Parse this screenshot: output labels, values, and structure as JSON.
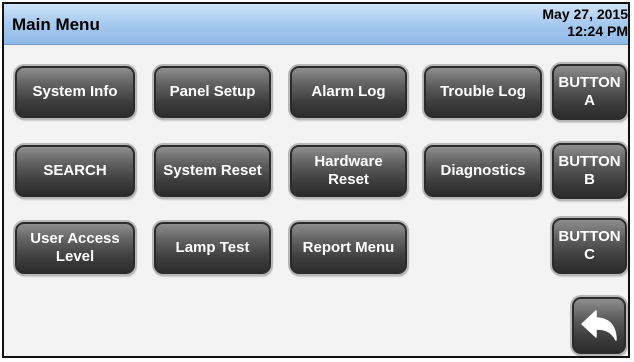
{
  "header": {
    "title": "Main Menu",
    "date": "May 27, 2015",
    "time": "12:24 PM"
  },
  "buttons": {
    "system_info": "System Info",
    "panel_setup": "Panel Setup",
    "alarm_log": "Alarm Log",
    "trouble_log": "Trouble Log",
    "button_a": "BUTTON\nA",
    "search": "SEARCH",
    "system_reset": "System Reset",
    "hardware_reset": "Hardware\nReset",
    "diagnostics": "Diagnostics",
    "button_b": "BUTTON\nB",
    "user_access_level": "User Access\nLevel",
    "lamp_test": "Lamp Test",
    "report_menu": "Report Menu",
    "button_c": "BUTTON\nC"
  },
  "icons": {
    "back": "back-arrow-icon"
  },
  "colors": {
    "header_top": "#cfe4f8",
    "header_bottom": "#8fb9e8",
    "button_dark": "#2c2c2c",
    "background": "#f3f3f3"
  }
}
